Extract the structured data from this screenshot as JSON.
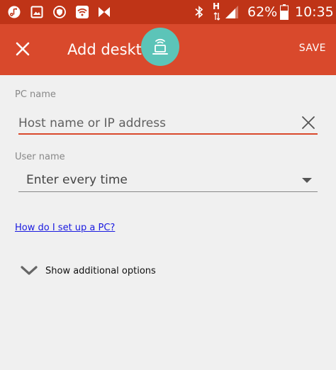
{
  "status_bar": {
    "network_type": "H",
    "battery_percent": "62%",
    "time": "10:35",
    "icons": [
      "music-icon",
      "image-icon",
      "shield-icon",
      "wifi-box-icon",
      "m-logo-icon",
      "bluetooth-icon",
      "signal-icon",
      "battery-icon"
    ]
  },
  "app_bar": {
    "title": "Add desktop",
    "save_label": "SAVE",
    "close_icon": "close-icon",
    "fab_icon": "desktop-connect-icon"
  },
  "form": {
    "pc_name": {
      "label": "PC name",
      "placeholder": "Host name or IP address",
      "value": ""
    },
    "user_name": {
      "label": "User name",
      "value": "Enter every time"
    },
    "help_link": "How do I set up a PC?",
    "additional_options": "Show additional options"
  },
  "colors": {
    "status_bar": "#bf3417",
    "app_bar": "#d9492c",
    "fab": "#5cc4b8",
    "accent": "#d9492c",
    "link": "#1a1ae0",
    "background": "#f0f0f0"
  }
}
